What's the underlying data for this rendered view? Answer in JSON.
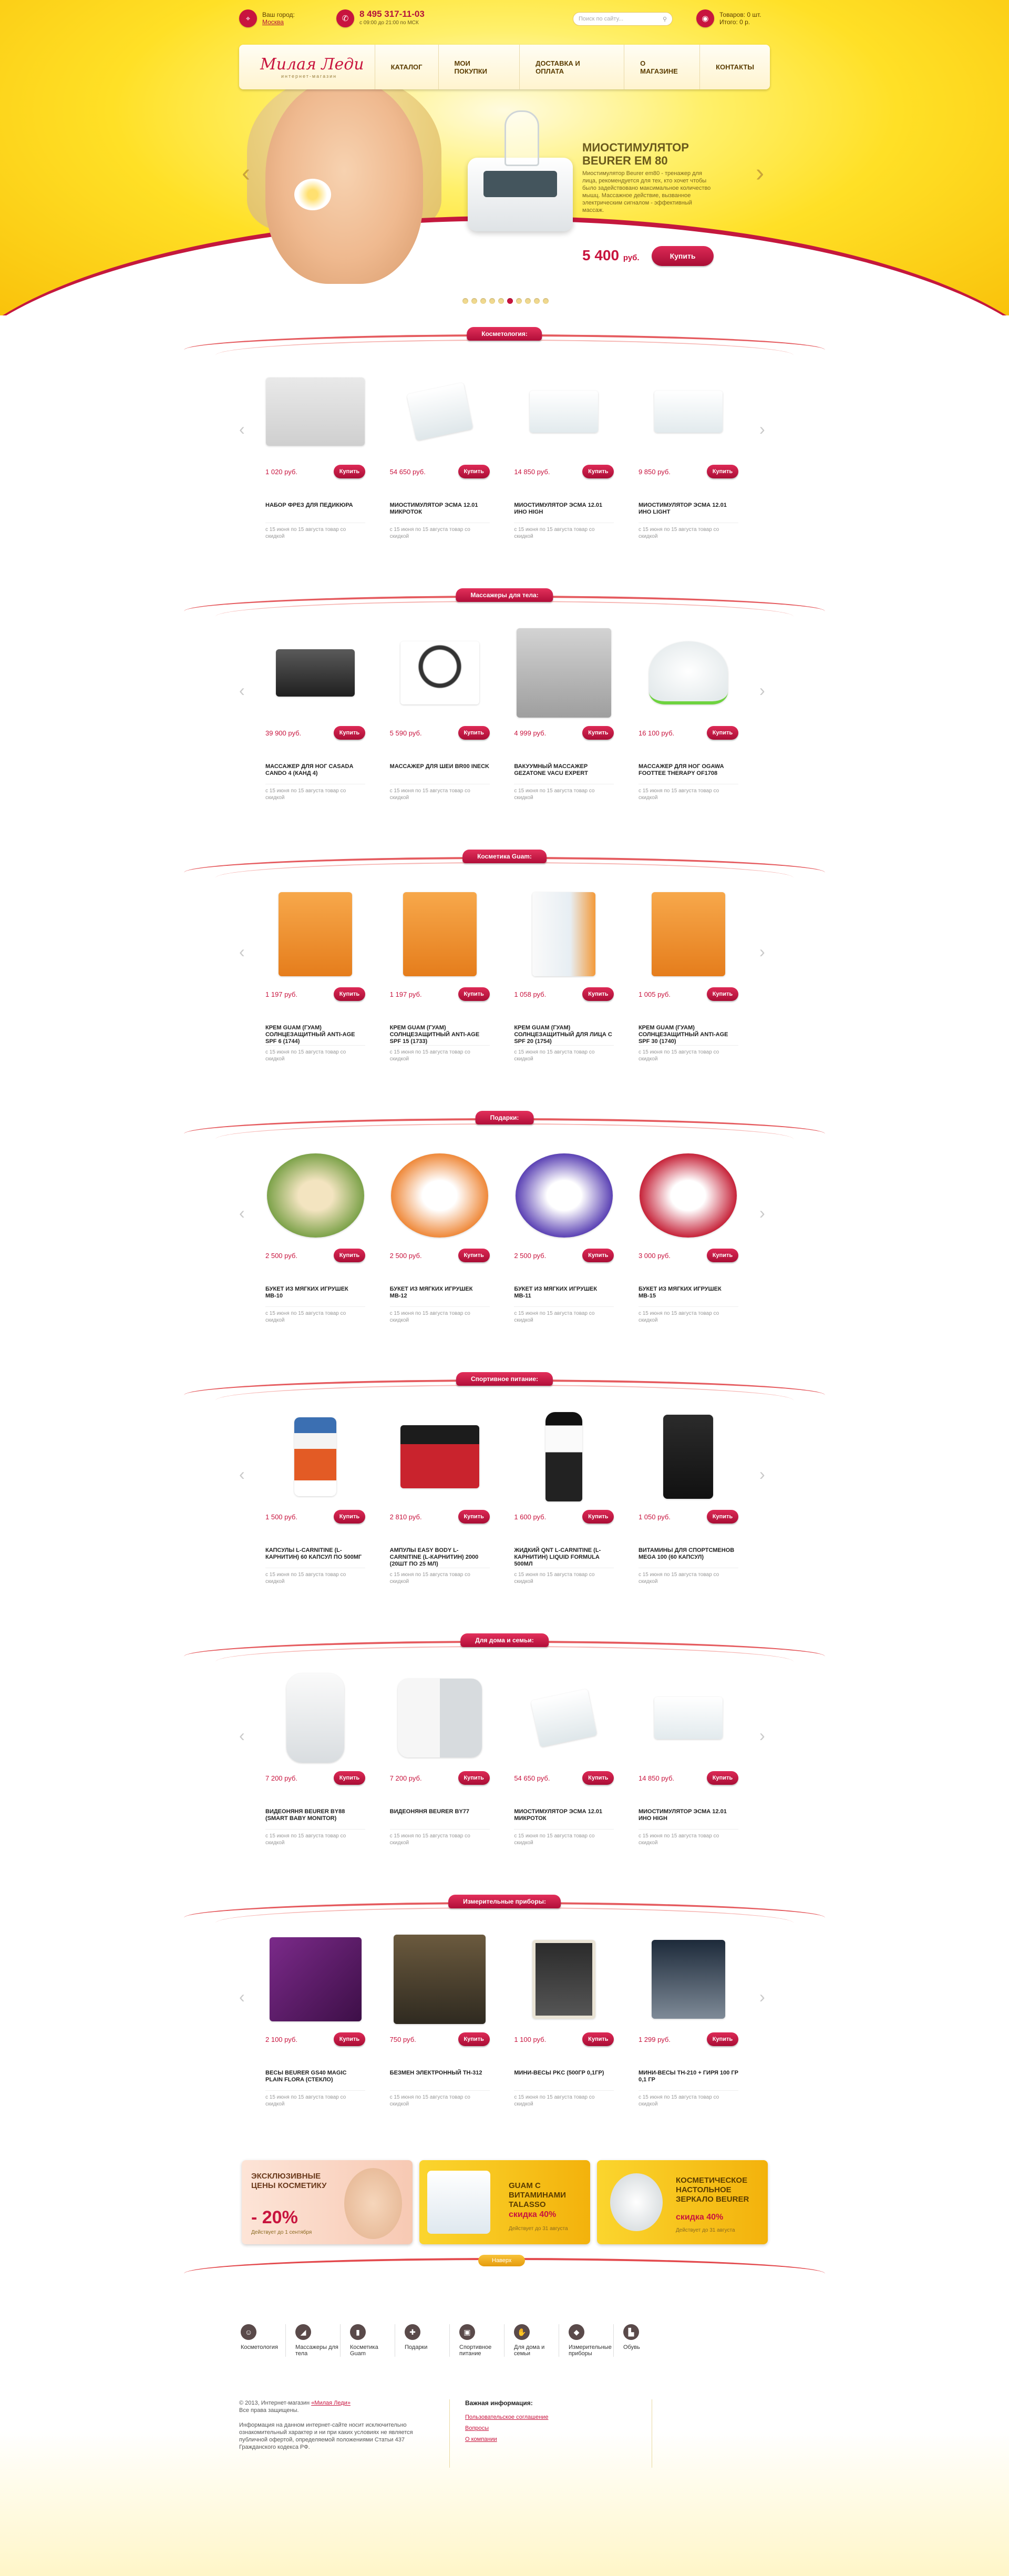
{
  "header": {
    "city_label": "Ваш город:",
    "city_value": "Москва",
    "phone": "8 495 317-11-03",
    "phone_hours": "с 09:00 до 21:00 по МСК",
    "search_placeholder": "Поиск по сайту...",
    "cart_goods": "Товаров: 0 шт.",
    "cart_total": "Итого: 0 р.",
    "logo_text": "Милая Леди",
    "logo_sub": "интернет-магазин"
  },
  "nav": [
    "Каталог",
    "Мои покупки",
    "Доставка и оплата",
    "О магазине",
    "Контакты"
  ],
  "slider": {
    "title_line1": "Миостимулятор",
    "title_line2": "Beurer EM 80",
    "description": "Миостимулятор Beurer em80 - тренажер для лица, рекомендуется для тех, кто хочет чтобы было задействовано максимальное количество мышц. Массажное действие, вызванное электрическим сигналом - эффективный массаж.",
    "price": "5 400",
    "currency": "руб.",
    "buy": "Купить",
    "dots": 10,
    "active_dot": 5
  },
  "buy_label": "Купить",
  "note": "с 15 июня по 15 августа товар со скидкой",
  "sections": [
    {
      "title": "Косметология:",
      "products": [
        {
          "price": "1 020 руб.",
          "name": "Набор фрез для педикюра",
          "img": "tools"
        },
        {
          "price": "54 650 руб.",
          "name": "Миостимулятор Эсма 12.01 Микроток",
          "img": "device"
        },
        {
          "price": "14 850 руб.",
          "name": "Миостимулятор Эсма 12.01 ИНО High",
          "img": "device2"
        },
        {
          "price": "9 850 руб.",
          "name": "Миостимулятор Эсма 12.01 ИНО Light",
          "img": "device2"
        }
      ]
    },
    {
      "title": "Массажеры для тела:",
      "products": [
        {
          "price": "39 900 руб.",
          "name": "Массажер для ног Casada Cando 4 (Канд 4)",
          "img": "legs"
        },
        {
          "price": "5 590 руб.",
          "name": "Массажер для шеи BR00 iNeck",
          "img": "ineck"
        },
        {
          "price": "4 999 руб.",
          "name": "Вакуумный массажер Gezatone Vacu Expert",
          "img": "vacu"
        },
        {
          "price": "16 100 руб.",
          "name": "Массажер для ног Ogawa Foottee Therapy OF1708",
          "img": "ogawa"
        }
      ]
    },
    {
      "title": "Косметика Guam:",
      "products": [
        {
          "price": "1 197 руб.",
          "name": "Крем Guam (Гуам) солнцезащитный Anti-Age SPF 6 (1744)",
          "img": "guam"
        },
        {
          "price": "1 197 руб.",
          "name": "Крем Guam (Гуам) солнцезащитный Anti-Age SPF 15 (1733)",
          "img": "guam"
        },
        {
          "price": "1 058 руб.",
          "name": "Крем Guam (Гуам) солнцезащитный для лица с SPF 20 (1754)",
          "img": "guam2"
        },
        {
          "price": "1 005 руб.",
          "name": "Крем Guam (Гуам) солнцезащитный Anti-Age SPF 30 (1740)",
          "img": "guam"
        }
      ]
    },
    {
      "title": "Подарки:",
      "products": [
        {
          "price": "2 500 руб.",
          "name": "Букет из мягких игрушек МВ-10",
          "img": "bouquet-green"
        },
        {
          "price": "2 500 руб.",
          "name": "Букет из мягких игрушек МВ-12",
          "img": "bouquet-orange"
        },
        {
          "price": "2 500 руб.",
          "name": "Букет из мягких игрушек МВ-11",
          "img": "bouquet-violet"
        },
        {
          "price": "3 000 руб.",
          "name": "Букет из мягких игрушек МВ-15",
          "img": "bouquet-red"
        }
      ]
    },
    {
      "title": "Спортивное питание:",
      "products": [
        {
          "price": "1 500 руб.",
          "name": "Капсулы L-Carnitine (L-карнитин) 60 капсул по 500мг",
          "img": "jar"
        },
        {
          "price": "2 810 руб.",
          "name": "Ампулы Easy Body L-Carnitine (L-карнитин) 2000 (20шт по 25 мл)",
          "img": "ampoules"
        },
        {
          "price": "1 600 руб.",
          "name": "Жидкий QNT L-Carnitine (L-карнитин) Liquid Formula 500мл",
          "img": "bottle"
        },
        {
          "price": "1 050 руб.",
          "name": "Витамины для спортсменов Mega 100 (60 капсул)",
          "img": "mega"
        }
      ]
    },
    {
      "title": "Для дома и семьи:",
      "products": [
        {
          "price": "7 200 руб.",
          "name": "Видеоняня Beurer BY88 (Smart Baby Monitor)",
          "img": "cam"
        },
        {
          "price": "7 200 руб.",
          "name": "Видеоняня Beurer BY77",
          "img": "cam2"
        },
        {
          "price": "54 650 руб.",
          "name": "Миостимулятор Эсма 12.01 Микроток",
          "img": "device"
        },
        {
          "price": "14 850 руб.",
          "name": "Миостимулятор Эсма 12.01 ИНО High",
          "img": "device2"
        }
      ]
    },
    {
      "title": "Измерительные приборы:",
      "products": [
        {
          "price": "2 100 руб.",
          "name": "Весы Beurer GS40 Magic Plain Flora (стекло)",
          "img": "scale-purple"
        },
        {
          "price": "750 руб.",
          "name": "Безмен электронный TH-312",
          "img": "bezmen"
        },
        {
          "price": "1 100 руб.",
          "name": "Мини-весы PKC (500гр 0,1гр)",
          "img": "miniscale"
        },
        {
          "price": "1 299 руб.",
          "name": "Мини-весы TH-210 + гиря 100 гр 0,1 гр",
          "img": "miniscale2"
        }
      ]
    }
  ],
  "promos": [
    {
      "line1": "Эксклюзивные",
      "line2": "цены косметику",
      "big": "- 20%",
      "sub": "Действует до 1 сентября"
    },
    {
      "line1": "Guam с",
      "line2": "витаминами Talasso",
      "big": "скидка 40%",
      "sub": "Действует до 31 августа"
    },
    {
      "line1": "Косметическое",
      "line2": "настольное зеркало Beurer",
      "big": "скидка 40%",
      "sub": "Действует до 31 августа"
    }
  ],
  "footer": {
    "tab": "Наверх",
    "categories": [
      {
        "label": "Косметология",
        "icon": "face-icon"
      },
      {
        "label": "Массажеры для тела",
        "icon": "massager-icon"
      },
      {
        "label": "Косметика Guam",
        "icon": "cosmetics-icon"
      },
      {
        "label": "Подарки",
        "icon": "gift-icon"
      },
      {
        "label": "Спортивное питание",
        "icon": "jar-icon"
      },
      {
        "label": "Для дома и семьи",
        "icon": "hand-icon"
      },
      {
        "label": "Измерительные приборы",
        "icon": "scale-icon"
      },
      {
        "label": "Обувь",
        "icon": "boot-icon"
      }
    ],
    "copyright": "© 2013, Интернет-магазин",
    "copyright_link": "«Милая Леди»",
    "rights": "Все права защищены.",
    "disclaimer": "Информация на данном интернет-сайте носит исключительно ознакомительный характер и ни при каких условиях не является публичной офертой, определяемой положениями Статьи 437 Гражданского кодекса РФ.",
    "info_title": "Важная информация:",
    "info_links": [
      "Пользовательское соглашение",
      "Вопросы",
      "О компании"
    ]
  }
}
